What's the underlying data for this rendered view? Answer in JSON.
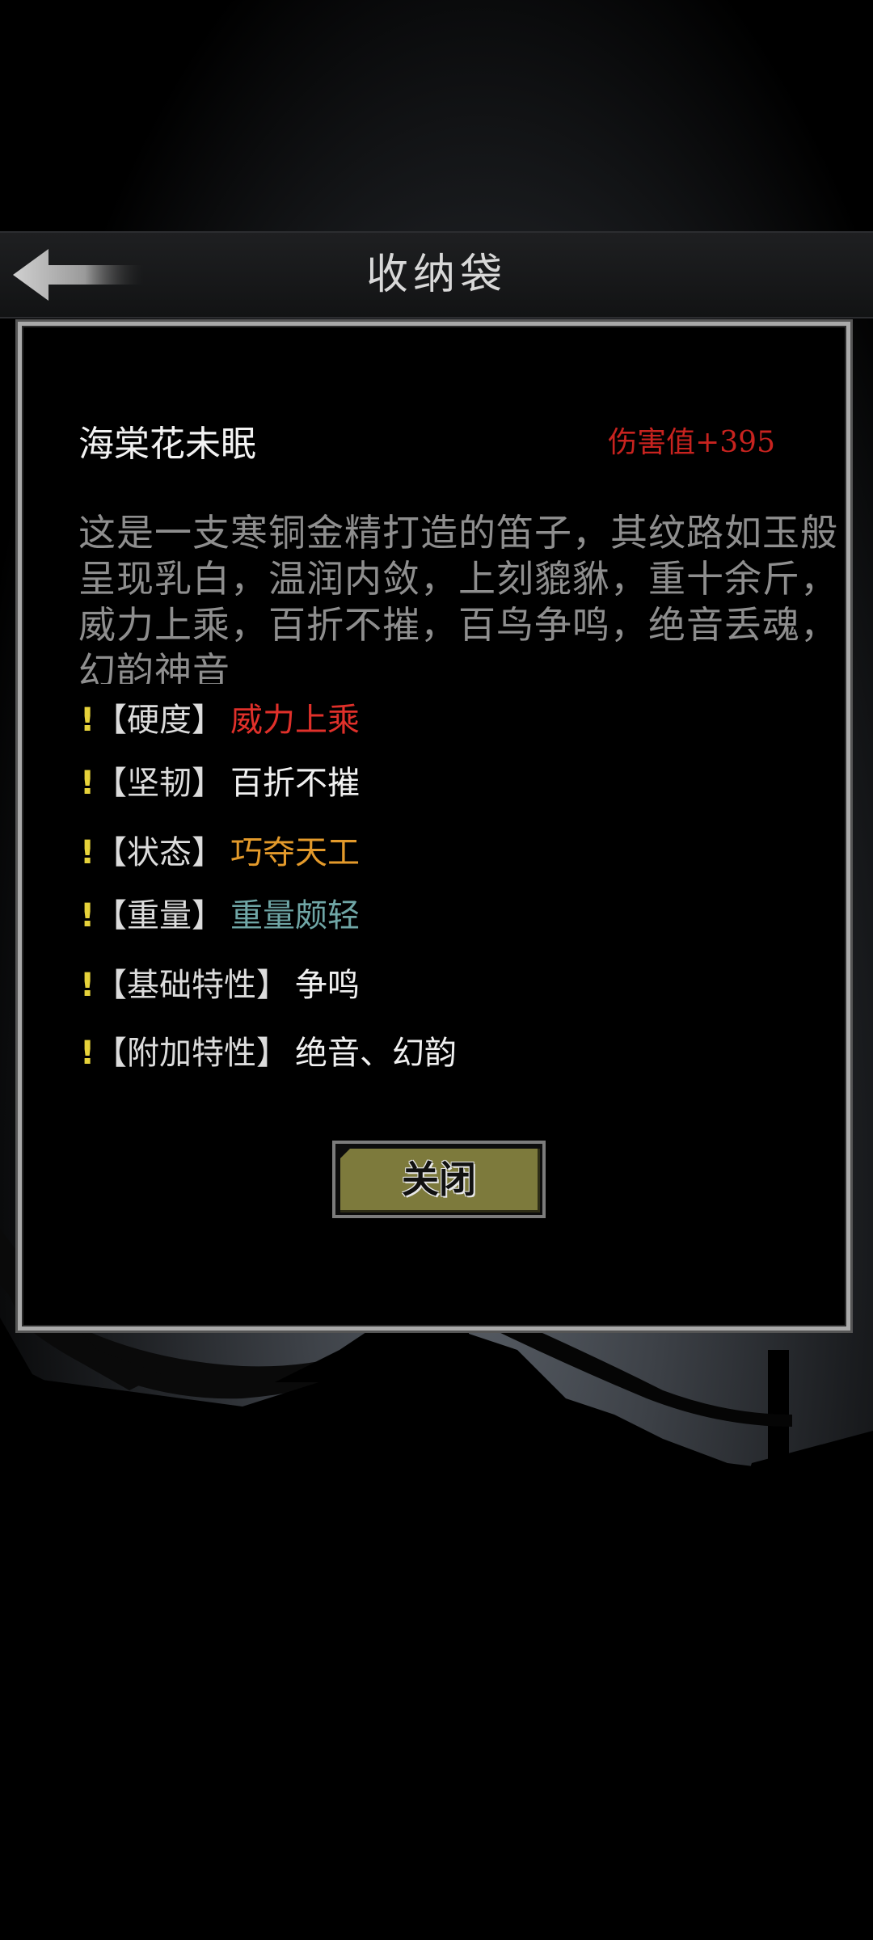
{
  "header": {
    "title": "收纳袋",
    "back_icon": "back-arrow-icon"
  },
  "item": {
    "name": "海棠花未眠",
    "stat": "伤害值+395",
    "stat_color": "#c8231f",
    "description": "这是一支寒铜金精打造的笛子，其纹路如玉般呈现乳白，温润内敛，上刻貔貅，重十余斤，威力上乘，百折不摧，百鸟争鸣，绝音丢魂，幻韵神音"
  },
  "attributes": [
    {
      "mark": "!",
      "label": "【硬度】",
      "value": "威力上乘",
      "color": "#e0302a"
    },
    {
      "mark": "!",
      "label": "【坚韧】",
      "value": "百折不摧",
      "color": "#f0f0f0"
    },
    {
      "mark": "!",
      "label": "【状态】",
      "value": "巧夺天工",
      "color": "#e39a2b"
    },
    {
      "mark": "!",
      "label": "【重量】",
      "value": "重量颇轻",
      "color": "#6fa6a6"
    },
    {
      "mark": "!",
      "label": "【基础特性】",
      "value": "争鸣",
      "color": "#f0f0f0"
    },
    {
      "mark": "!",
      "label": "【附加特性】",
      "value": "绝音、幻韵",
      "color": "#f0f0f0"
    }
  ],
  "close_button": {
    "label": "关闭",
    "color": "#7d7a3c"
  }
}
